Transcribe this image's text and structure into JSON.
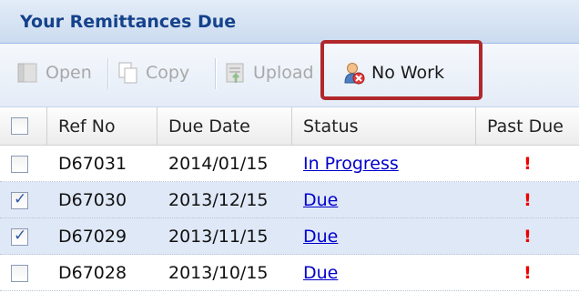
{
  "panel": {
    "title": "Your Remittances Due"
  },
  "toolbar": {
    "open_label": "Open",
    "copy_label": "Copy",
    "upload_label": "Upload",
    "no_work_label": "No Work"
  },
  "grid": {
    "columns": [
      "Ref No",
      "Due Date",
      "Status",
      "Past Due"
    ],
    "rows": [
      {
        "checked": false,
        "ref_no": "D67031",
        "due_date": "2014/01/15",
        "status": "In Progress",
        "past_due": "!"
      },
      {
        "checked": true,
        "ref_no": "D67030",
        "due_date": "2013/12/15",
        "status": "Due",
        "past_due": "!"
      },
      {
        "checked": true,
        "ref_no": "D67029",
        "due_date": "2013/11/15",
        "status": "Due",
        "past_due": "!"
      },
      {
        "checked": false,
        "ref_no": "D67028",
        "due_date": "2013/10/15",
        "status": "Due",
        "past_due": "!"
      }
    ]
  },
  "colors": {
    "title": "#15428b",
    "link": "#0000cc",
    "past_due": "#ee0000",
    "highlight": "#b0282b",
    "selected_row": "#dfe8f6"
  }
}
